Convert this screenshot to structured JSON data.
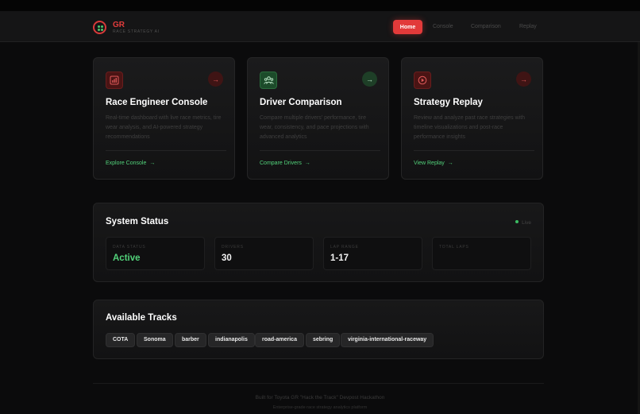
{
  "nav": {
    "logo_title": "GR",
    "logo_subtitle": "RACE STRATEGY AI",
    "home": "Home",
    "console": "Console",
    "comparison": "Comparison",
    "replay": "Replay"
  },
  "cards": [
    {
      "title": "Race Engineer Console",
      "description": "Real-time dashboard with live race metrics, tire wear analysis, and AI-powered strategy recommendations",
      "link": "Explore Console",
      "icon": "bar-chart-icon",
      "accent": "#e23a3a"
    },
    {
      "title": "Driver Comparison",
      "description": "Compare multiple drivers' performance, tire wear, consistency, and pace projections with advanced analytics",
      "link": "Compare Drivers",
      "icon": "users-icon",
      "accent": "#3bbd63"
    },
    {
      "title": "Strategy Replay",
      "description": "Review and analyze past race strategies with timeline visualizations and post-race performance insights",
      "link": "View Replay",
      "icon": "play-circle-icon",
      "accent": "#e23a3a"
    }
  ],
  "system_status": {
    "title": "System Status",
    "live_label": "Live",
    "stats": [
      {
        "label": "DATA STATUS",
        "value": "Active"
      },
      {
        "label": "DRIVERS",
        "value": "30"
      },
      {
        "label": "LAP RANGE",
        "value": "1-17"
      },
      {
        "label": "TOTAL LAPS",
        "value": ""
      }
    ]
  },
  "tracks": {
    "title": "Available Tracks",
    "items": [
      "COTA",
      "Sonoma",
      "barber",
      "indianapolis",
      "road-america",
      "sebring",
      "virginia-international-raceway"
    ]
  },
  "footer": {
    "line1": "Built for Toyota GR \"Hack the Track\" Devpost Hackathon",
    "line2": "Enterprise-grade race strategy analytics platform"
  },
  "colors": {
    "accent_red": "#e23a3a",
    "accent_green": "#52d27a",
    "background": "#0b0b0c"
  }
}
